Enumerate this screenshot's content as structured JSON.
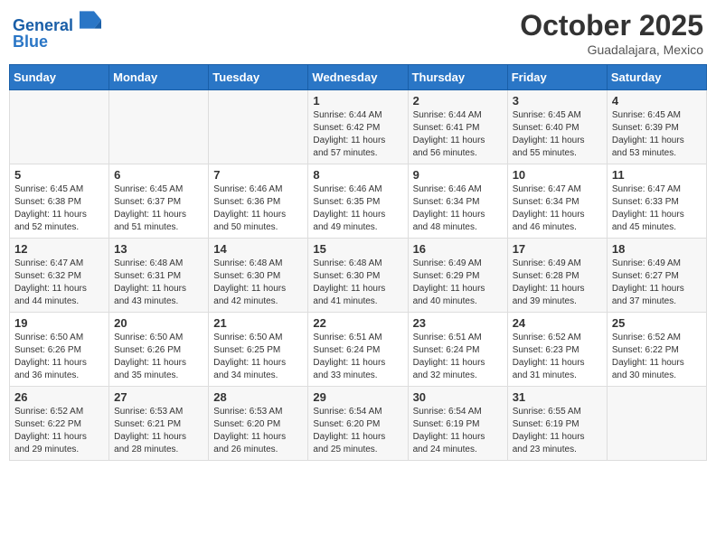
{
  "header": {
    "logo_line1": "General",
    "logo_line2": "Blue",
    "month": "October 2025",
    "location": "Guadalajara, Mexico"
  },
  "weekdays": [
    "Sunday",
    "Monday",
    "Tuesday",
    "Wednesday",
    "Thursday",
    "Friday",
    "Saturday"
  ],
  "weeks": [
    [
      {
        "day": "",
        "info": ""
      },
      {
        "day": "",
        "info": ""
      },
      {
        "day": "",
        "info": ""
      },
      {
        "day": "1",
        "info": "Sunrise: 6:44 AM\nSunset: 6:42 PM\nDaylight: 11 hours\nand 57 minutes."
      },
      {
        "day": "2",
        "info": "Sunrise: 6:44 AM\nSunset: 6:41 PM\nDaylight: 11 hours\nand 56 minutes."
      },
      {
        "day": "3",
        "info": "Sunrise: 6:45 AM\nSunset: 6:40 PM\nDaylight: 11 hours\nand 55 minutes."
      },
      {
        "day": "4",
        "info": "Sunrise: 6:45 AM\nSunset: 6:39 PM\nDaylight: 11 hours\nand 53 minutes."
      }
    ],
    [
      {
        "day": "5",
        "info": "Sunrise: 6:45 AM\nSunset: 6:38 PM\nDaylight: 11 hours\nand 52 minutes."
      },
      {
        "day": "6",
        "info": "Sunrise: 6:45 AM\nSunset: 6:37 PM\nDaylight: 11 hours\nand 51 minutes."
      },
      {
        "day": "7",
        "info": "Sunrise: 6:46 AM\nSunset: 6:36 PM\nDaylight: 11 hours\nand 50 minutes."
      },
      {
        "day": "8",
        "info": "Sunrise: 6:46 AM\nSunset: 6:35 PM\nDaylight: 11 hours\nand 49 minutes."
      },
      {
        "day": "9",
        "info": "Sunrise: 6:46 AM\nSunset: 6:34 PM\nDaylight: 11 hours\nand 48 minutes."
      },
      {
        "day": "10",
        "info": "Sunrise: 6:47 AM\nSunset: 6:34 PM\nDaylight: 11 hours\nand 46 minutes."
      },
      {
        "day": "11",
        "info": "Sunrise: 6:47 AM\nSunset: 6:33 PM\nDaylight: 11 hours\nand 45 minutes."
      }
    ],
    [
      {
        "day": "12",
        "info": "Sunrise: 6:47 AM\nSunset: 6:32 PM\nDaylight: 11 hours\nand 44 minutes."
      },
      {
        "day": "13",
        "info": "Sunrise: 6:48 AM\nSunset: 6:31 PM\nDaylight: 11 hours\nand 43 minutes."
      },
      {
        "day": "14",
        "info": "Sunrise: 6:48 AM\nSunset: 6:30 PM\nDaylight: 11 hours\nand 42 minutes."
      },
      {
        "day": "15",
        "info": "Sunrise: 6:48 AM\nSunset: 6:30 PM\nDaylight: 11 hours\nand 41 minutes."
      },
      {
        "day": "16",
        "info": "Sunrise: 6:49 AM\nSunset: 6:29 PM\nDaylight: 11 hours\nand 40 minutes."
      },
      {
        "day": "17",
        "info": "Sunrise: 6:49 AM\nSunset: 6:28 PM\nDaylight: 11 hours\nand 39 minutes."
      },
      {
        "day": "18",
        "info": "Sunrise: 6:49 AM\nSunset: 6:27 PM\nDaylight: 11 hours\nand 37 minutes."
      }
    ],
    [
      {
        "day": "19",
        "info": "Sunrise: 6:50 AM\nSunset: 6:26 PM\nDaylight: 11 hours\nand 36 minutes."
      },
      {
        "day": "20",
        "info": "Sunrise: 6:50 AM\nSunset: 6:26 PM\nDaylight: 11 hours\nand 35 minutes."
      },
      {
        "day": "21",
        "info": "Sunrise: 6:50 AM\nSunset: 6:25 PM\nDaylight: 11 hours\nand 34 minutes."
      },
      {
        "day": "22",
        "info": "Sunrise: 6:51 AM\nSunset: 6:24 PM\nDaylight: 11 hours\nand 33 minutes."
      },
      {
        "day": "23",
        "info": "Sunrise: 6:51 AM\nSunset: 6:24 PM\nDaylight: 11 hours\nand 32 minutes."
      },
      {
        "day": "24",
        "info": "Sunrise: 6:52 AM\nSunset: 6:23 PM\nDaylight: 11 hours\nand 31 minutes."
      },
      {
        "day": "25",
        "info": "Sunrise: 6:52 AM\nSunset: 6:22 PM\nDaylight: 11 hours\nand 30 minutes."
      }
    ],
    [
      {
        "day": "26",
        "info": "Sunrise: 6:52 AM\nSunset: 6:22 PM\nDaylight: 11 hours\nand 29 minutes."
      },
      {
        "day": "27",
        "info": "Sunrise: 6:53 AM\nSunset: 6:21 PM\nDaylight: 11 hours\nand 28 minutes."
      },
      {
        "day": "28",
        "info": "Sunrise: 6:53 AM\nSunset: 6:20 PM\nDaylight: 11 hours\nand 26 minutes."
      },
      {
        "day": "29",
        "info": "Sunrise: 6:54 AM\nSunset: 6:20 PM\nDaylight: 11 hours\nand 25 minutes."
      },
      {
        "day": "30",
        "info": "Sunrise: 6:54 AM\nSunset: 6:19 PM\nDaylight: 11 hours\nand 24 minutes."
      },
      {
        "day": "31",
        "info": "Sunrise: 6:55 AM\nSunset: 6:19 PM\nDaylight: 11 hours\nand 23 minutes."
      },
      {
        "day": "",
        "info": ""
      }
    ]
  ]
}
